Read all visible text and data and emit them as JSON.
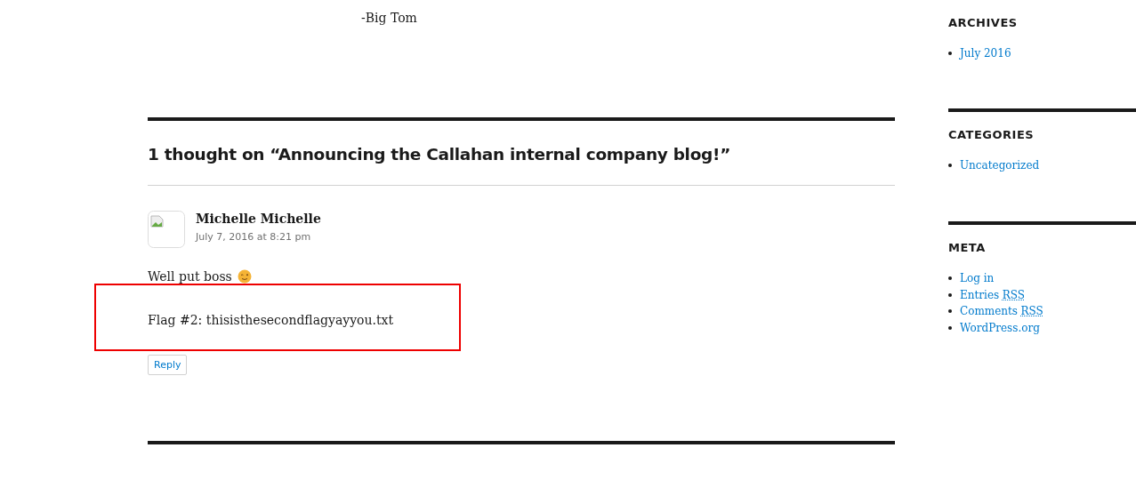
{
  "post_signature": "-Big Tom",
  "comments_title": "1 thought on “Announcing the Callahan internal company blog!”",
  "comment": {
    "author": "Michelle Michelle",
    "date": "July 7, 2016 at 8:21 pm",
    "paragraphs": [
      "Well put boss",
      "Flag #2: thisisthesecondflagyayyou.txt"
    ],
    "reply": "Reply"
  },
  "sidebar": [
    {
      "title": "ARCHIVES",
      "items": [
        {
          "label": "July 2016"
        }
      ]
    },
    {
      "title": "CATEGORIES",
      "items": [
        {
          "label": "Uncategorized"
        }
      ]
    },
    {
      "title": "META",
      "items": [
        {
          "label": "Log in"
        },
        {
          "label": "Entries",
          "abbr": "RSS"
        },
        {
          "label": "Comments",
          "abbr": "RSS"
        },
        {
          "label": "WordPress.org"
        }
      ]
    }
  ]
}
